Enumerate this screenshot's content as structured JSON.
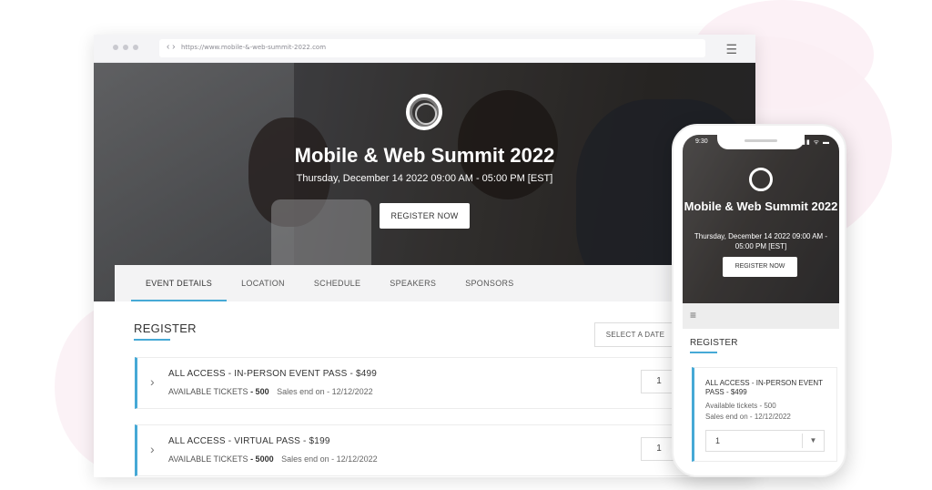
{
  "browser": {
    "url": "https://www.mobile-&-web-summit-2022.com",
    "menu_icon": "hamburger-icon"
  },
  "hero": {
    "title": "Mobile & Web Summit 2022",
    "date": "Thursday, December 14 2022 09:00 AM - 05:00 PM [EST]",
    "register_label": "REGISTER NOW"
  },
  "tabs": [
    {
      "label": "EVENT DETAILS",
      "active": true
    },
    {
      "label": "LOCATION",
      "active": false
    },
    {
      "label": "SCHEDULE",
      "active": false
    },
    {
      "label": "SPEAKERS",
      "active": false
    },
    {
      "label": "SPONSORS",
      "active": false
    }
  ],
  "register": {
    "title": "REGISTER",
    "select_date": "SELECT A DATE",
    "tickets": [
      {
        "name": "ALL ACCESS - IN-PERSON EVENT PASS - $499",
        "available_label": "AVAILABLE TICKETS",
        "available": "- 500",
        "sales_end": "Sales end on - 12/12/2022",
        "qty": "1"
      },
      {
        "name": "ALL ACCESS - VIRTUAL PASS - $199",
        "available_label": "AVAILABLE TICKETS",
        "available": "- 5000",
        "sales_end": "Sales end on - 12/12/2022",
        "qty": "1"
      }
    ]
  },
  "phone": {
    "time": "9:30",
    "status": "▮▮ ᯤ ▬",
    "title": "Mobile & Web Summit 2022",
    "date": "Thursday, December 14 2022 09:00 AM - 05:00 PM [EST]",
    "register_label": "REGISTER NOW",
    "menu_icon": "≡",
    "section_title": "REGISTER",
    "ticket": {
      "name": "ALL ACCESS - IN-PERSON EVENT PASS - $499",
      "available": "Available tickets - 500",
      "sales_end": "Sales end on - 12/12/2022",
      "qty": "1",
      "caret": "▼"
    }
  },
  "colors": {
    "accent": "#46a9d6",
    "blob": "#fbeef4"
  }
}
